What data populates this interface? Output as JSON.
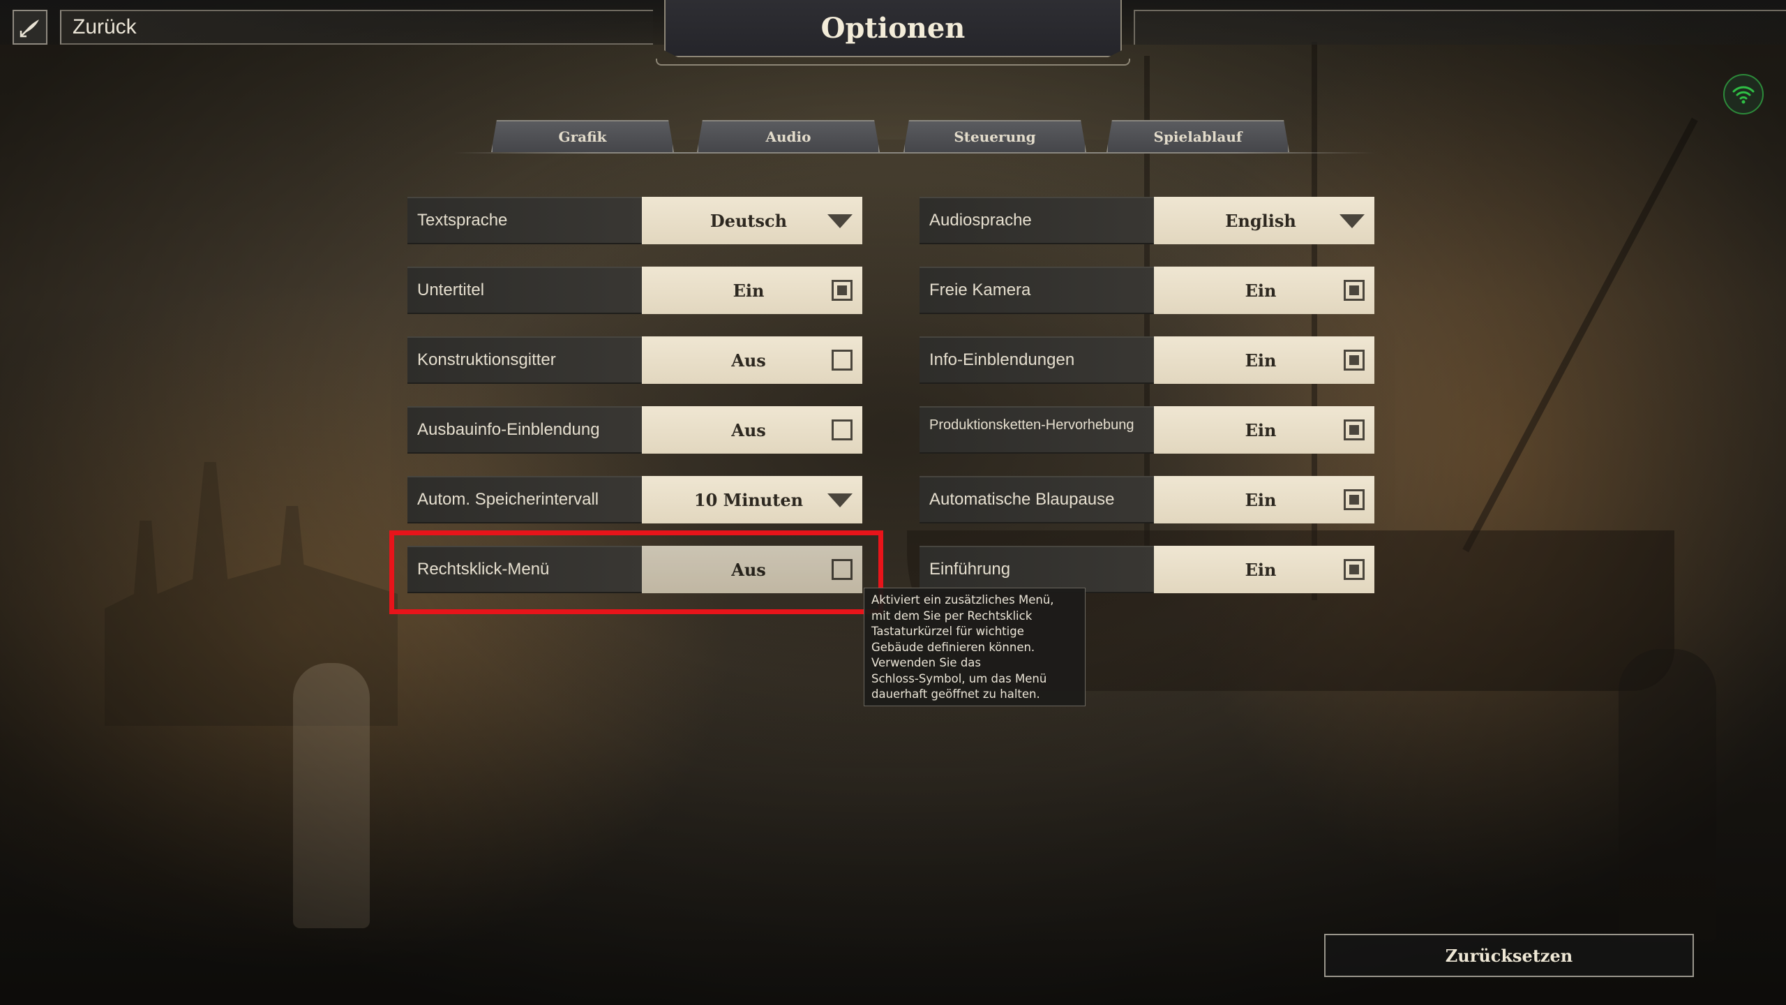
{
  "header": {
    "back_label": "Zurück",
    "title": "Optionen"
  },
  "tabs": [
    {
      "label": "Grafik"
    },
    {
      "label": "Audio"
    },
    {
      "label": "Steuerung"
    },
    {
      "label": "Spielablauf"
    }
  ],
  "left_settings": [
    {
      "label": "Textsprache",
      "value": "Deutsch",
      "control": "dropdown"
    },
    {
      "label": "Untertitel",
      "value": "Ein",
      "control": "checkbox",
      "checked": true
    },
    {
      "label": "Konstruktionsgitter",
      "value": "Aus",
      "control": "checkbox",
      "checked": false
    },
    {
      "label": "Ausbauinfo-Einblendung",
      "value": "Aus",
      "control": "checkbox",
      "checked": false
    },
    {
      "label": "Autom. Speicherintervall",
      "value": "10 Minuten",
      "control": "dropdown"
    },
    {
      "label": "Rechtsklick-Menü",
      "value": "Aus",
      "control": "checkbox",
      "checked": false
    }
  ],
  "right_settings": [
    {
      "label": "Audiosprache",
      "value": "English",
      "control": "dropdown"
    },
    {
      "label": "Freie Kamera",
      "value": "Ein",
      "control": "checkbox",
      "checked": true
    },
    {
      "label": "Info-Einblendungen",
      "value": "Ein",
      "control": "checkbox",
      "checked": true
    },
    {
      "label": "Produktionsketten-Hervorhebung",
      "value": "Ein",
      "control": "checkbox",
      "checked": true
    },
    {
      "label": "Automatische Blaupause",
      "value": "Ein",
      "control": "checkbox",
      "checked": true
    },
    {
      "label": "Einführung",
      "value": "Ein",
      "control": "checkbox",
      "checked": true
    }
  ],
  "tooltip": {
    "text": "Aktiviert ein zusätzliches Menü,\nmit dem Sie per Rechtsklick\nTastaturkürzel für wichtige\nGebäude definieren können.\nVerwenden Sie das\nSchloss-Symbol, um das Menü\ndauerhaft geöffnet zu halten."
  },
  "footer": {
    "reset_label": "Zurücksetzen"
  },
  "colors": {
    "highlight": "#e8141a",
    "online_indicator": "#2c8a3a"
  },
  "icons": {
    "back": "quill-back-icon",
    "network": "wifi-icon",
    "dropdown": "chevron-down-icon"
  }
}
